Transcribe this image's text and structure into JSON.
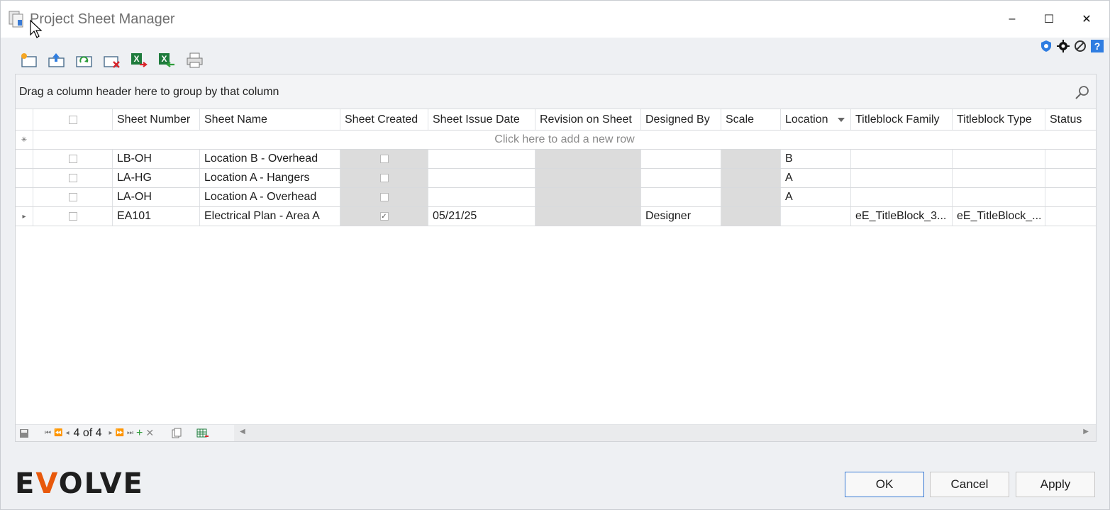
{
  "window": {
    "title": "Project Sheet Manager",
    "controls": {
      "minimize": "–",
      "maximize": "☐",
      "close": "✕"
    }
  },
  "toolbar": {
    "buttons": [
      "new-sheet-icon",
      "upload-icon",
      "refresh-icon",
      "delete-sheet-icon",
      "export-excel-icon",
      "import-excel-icon",
      "print-icon"
    ]
  },
  "top_icons": [
    "shield-icon",
    "gear-icon",
    "gear-alt-icon",
    "help-icon"
  ],
  "grid": {
    "group_panel_text": "Drag a column header here to group by that column",
    "new_row_text": "Click here to add a new row",
    "columns": [
      "Sheet Number",
      "Sheet Name",
      "Sheet Created",
      "Sheet Issue Date",
      "Revision on Sheet",
      "Designed By",
      "Scale",
      "Location",
      "Titleblock Family",
      "Titleblock Type",
      "Status"
    ],
    "rows": [
      {
        "number": "LB-OH",
        "name": "Location B - Overhead",
        "created": false,
        "issue_date": "",
        "revision": "",
        "designed_by": "",
        "scale": "",
        "location": "B",
        "tb_family": "",
        "tb_type": "",
        "status": ""
      },
      {
        "number": "LA-HG",
        "name": "Location A - Hangers",
        "created": false,
        "issue_date": "",
        "revision": "",
        "designed_by": "",
        "scale": "",
        "location": "A",
        "tb_family": "",
        "tb_type": "",
        "status": ""
      },
      {
        "number": "LA-OH",
        "name": "Location A - Overhead",
        "created": false,
        "issue_date": "",
        "revision": "",
        "designed_by": "",
        "scale": "",
        "location": "A",
        "tb_family": "",
        "tb_type": "",
        "status": ""
      },
      {
        "number": "EA101",
        "name": "Electrical Plan - Area A",
        "created": true,
        "issue_date": "05/21/25",
        "revision": "",
        "designed_by": "Designer",
        "scale": "",
        "location": "",
        "tb_family": "eE_TitleBlock_3...",
        "tb_type": "eE_TitleBlock_...",
        "status": ""
      }
    ],
    "navigator": {
      "record_text": "4 of 4"
    }
  },
  "footer": {
    "logo_text_pre": "E",
    "logo_text_v": "V",
    "logo_text_post": "OLVE",
    "ok_label": "OK",
    "cancel_label": "Cancel",
    "apply_label": "Apply"
  },
  "colors": {
    "accent": "#3a7bd5",
    "logo_v": "#e8590c",
    "readonly_cell": "#dcdcdc"
  }
}
